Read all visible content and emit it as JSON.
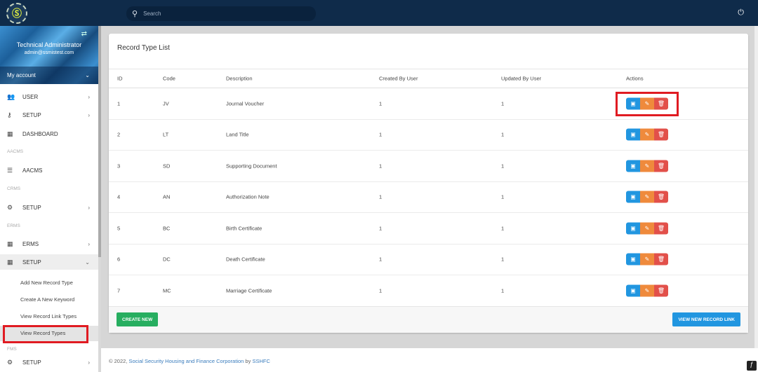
{
  "topbar": {
    "search_placeholder": "Search",
    "power_icon": "power-icon"
  },
  "profile": {
    "name": "Technical Administrator",
    "email": "admin@ssmistest.com",
    "account_label": "My account"
  },
  "sidebar": {
    "items": [
      {
        "label": "USER",
        "icon": "users-icon"
      },
      {
        "label": "SETUP",
        "icon": "key-icon"
      },
      {
        "label": "DASHBOARD",
        "icon": "dashboard-icon"
      },
      {
        "label": "AACMS",
        "icon": "list-icon"
      },
      {
        "label": "SETUP",
        "icon": "cogs-icon"
      },
      {
        "label": "ERMS",
        "icon": "calendar-icon"
      },
      {
        "label": "SETUP",
        "icon": "calendar-icon"
      },
      {
        "label": "SETUP",
        "icon": "cogs-icon"
      }
    ],
    "sections": [
      "AACMS",
      "CRMS",
      "ERMS",
      "FMS"
    ],
    "subitems": [
      "Add New Record Type",
      "Create A New Keyword",
      "View Record Link Types",
      "View Record Types"
    ]
  },
  "card": {
    "title": "Record Type List",
    "columns": [
      "ID",
      "Code",
      "Description",
      "Created By User",
      "Updated By User",
      "Actions"
    ],
    "rows": [
      {
        "id": "1",
        "code": "JV",
        "description": "Journal Voucher",
        "created": "1",
        "updated": "1"
      },
      {
        "id": "2",
        "code": "LT",
        "description": "Land Title",
        "created": "1",
        "updated": "1"
      },
      {
        "id": "3",
        "code": "SD",
        "description": "Supporting Document",
        "created": "1",
        "updated": "1"
      },
      {
        "id": "4",
        "code": "AN",
        "description": "Authorization Note",
        "created": "1",
        "updated": "1"
      },
      {
        "id": "5",
        "code": "BC",
        "description": "Birth Certificate",
        "created": "1",
        "updated": "1"
      },
      {
        "id": "6",
        "code": "DC",
        "description": "Death Certificate",
        "created": "1",
        "updated": "1"
      },
      {
        "id": "7",
        "code": "MC",
        "description": "Marriage Certificate",
        "created": "1",
        "updated": "1"
      }
    ],
    "create_label": "CREATE NEW",
    "view_link_label": "VIEW NEW RECORD LINK"
  },
  "footer": {
    "prefix": "© 2022,",
    "org": "Social Security Housing and Finance Corporation",
    "by": "by",
    "brand": "SSHFC"
  },
  "colors": {
    "topbar": "#0f2b4a",
    "view": "#2196e0",
    "edit": "#ef8a3c",
    "delete": "#e2504a",
    "create": "#27ae60",
    "highlight": "#e01b22"
  }
}
